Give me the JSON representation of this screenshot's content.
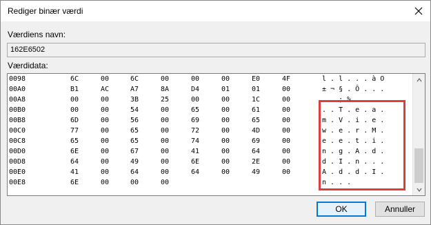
{
  "dialog": {
    "title": "Rediger binær værdi",
    "name_label": "Værdiens navn:",
    "name_value": "162E6502",
    "data_label": "Værdidata:",
    "ok_label": "OK",
    "cancel_label": "Annuller"
  },
  "hex_rows": [
    {
      "addr": "0098",
      "bytes": [
        "6C",
        "00",
        "6C",
        "00",
        "00",
        "00",
        "E0",
        "4F"
      ],
      "ascii": "l . l . . . à O"
    },
    {
      "addr": "00A0",
      "bytes": [
        "B1",
        "AC",
        "A7",
        "8A",
        "D4",
        "01",
        "01",
        "00"
      ],
      "ascii": "± ¬ § . Ô . . ."
    },
    {
      "addr": "00A8",
      "bytes": [
        "00",
        "00",
        "3B",
        "25",
        "00",
        "00",
        "1C",
        "00"
      ],
      "ascii": ". . ; % . . . ."
    },
    {
      "addr": "00B0",
      "bytes": [
        "00",
        "00",
        "54",
        "00",
        "65",
        "00",
        "61",
        "00"
      ],
      "ascii": ". . T . e . a ."
    },
    {
      "addr": "00B8",
      "bytes": [
        "6D",
        "00",
        "56",
        "00",
        "69",
        "00",
        "65",
        "00"
      ],
      "ascii": "m . V . i . e ."
    },
    {
      "addr": "00C0",
      "bytes": [
        "77",
        "00",
        "65",
        "00",
        "72",
        "00",
        "4D",
        "00"
      ],
      "ascii": "w . e . r . M ."
    },
    {
      "addr": "00C8",
      "bytes": [
        "65",
        "00",
        "65",
        "00",
        "74",
        "00",
        "69",
        "00"
      ],
      "ascii": "e . e . t . i ."
    },
    {
      "addr": "00D0",
      "bytes": [
        "6E",
        "00",
        "67",
        "00",
        "41",
        "00",
        "64",
        "00"
      ],
      "ascii": "n . g . A . d ."
    },
    {
      "addr": "00D8",
      "bytes": [
        "64",
        "00",
        "49",
        "00",
        "6E",
        "00",
        "2E",
        "00"
      ],
      "ascii": "d . I . n . . ."
    },
    {
      "addr": "00E0",
      "bytes": [
        "41",
        "00",
        "64",
        "00",
        "64",
        "00",
        "49",
        "00"
      ],
      "ascii": "A . d . d . I ."
    },
    {
      "addr": "00E8",
      "bytes": [
        "6E",
        "00",
        "00",
        "00"
      ],
      "ascii": "n . . ."
    }
  ],
  "colors": {
    "highlight": "#e03c3c",
    "accent": "#0078d7"
  }
}
